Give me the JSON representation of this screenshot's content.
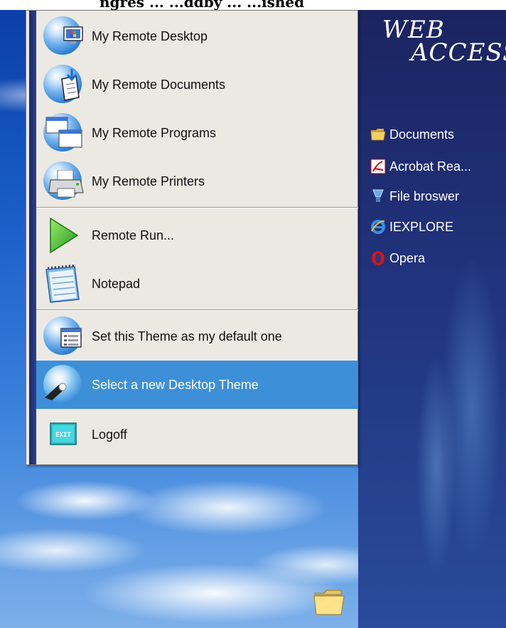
{
  "caption": "ngrés ... ...ddby ... ...ished",
  "logo": {
    "line1": "WEB",
    "line2": "ACCESS"
  },
  "start_menu": {
    "items": [
      {
        "label": "My Remote Desktop",
        "icon": "remote-desktop-icon"
      },
      {
        "label": "My Remote Documents",
        "icon": "remote-documents-icon"
      },
      {
        "label": "My Remote Programs",
        "icon": "remote-programs-icon"
      },
      {
        "label": "My Remote Printers",
        "icon": "remote-printers-icon"
      },
      {
        "label": "Remote Run...",
        "icon": "play-arrow-icon"
      },
      {
        "label": "Notepad",
        "icon": "notepad-icon"
      },
      {
        "label": "Set this Theme as my default one",
        "icon": "set-theme-icon"
      },
      {
        "label": "Select a new Desktop Theme",
        "icon": "desktop-theme-icon",
        "selected": true
      },
      {
        "label": "Logoff",
        "icon": "exit-icon"
      }
    ]
  },
  "side_panel": {
    "shortcuts": [
      {
        "label": "Documents",
        "icon": "folder-icon"
      },
      {
        "label": "Acrobat Rea...",
        "icon": "acrobat-icon"
      },
      {
        "label": "File broswer",
        "icon": "file-browser-icon"
      },
      {
        "label": "IEXPLORE",
        "icon": "internet-explorer-icon"
      },
      {
        "label": "Opera",
        "icon": "opera-icon"
      }
    ]
  },
  "colors": {
    "menu_bg": "#ece9e3",
    "selected_bg": "#3d8fd8",
    "sidebar_bar": "#1c2a6d",
    "panel_bg": "#1f2e74"
  }
}
